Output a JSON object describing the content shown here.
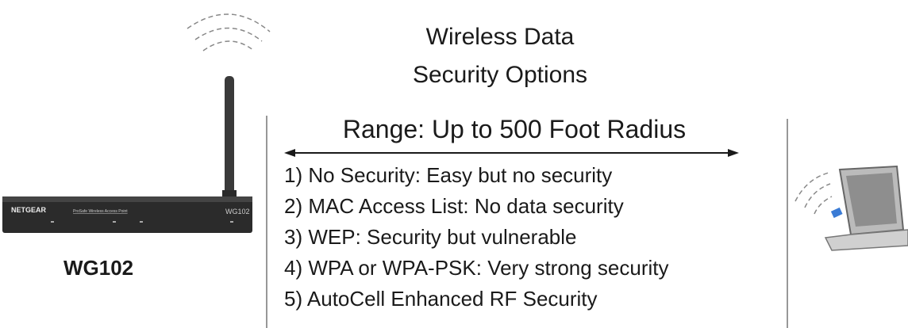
{
  "title": {
    "line1": "Wireless Data",
    "line2": "Security Options"
  },
  "range": "Range: Up to 500 Foot Radius",
  "options": [
    "1) No Security:  Easy but no security",
    "2) MAC Access List:  No data security",
    "3) WEP:  Security but vulnerable",
    "4) WPA or WPA-PSK:  Very strong security",
    "5) AutoCell Enhanced RF Security"
  ],
  "device": {
    "brand": "NETGEAR",
    "product_line": "ProSafe Wireless Access Point",
    "model_badge": "WG102",
    "model_label": "WG102"
  },
  "colors": {
    "ink": "#1a1a1a",
    "device_body": "#2b2b2b",
    "laptop_screen": "#b8b8b8",
    "wifi_arc": "#888888"
  },
  "icons": [
    "wireless-signal-icon",
    "access-point-icon",
    "laptop-icon"
  ]
}
